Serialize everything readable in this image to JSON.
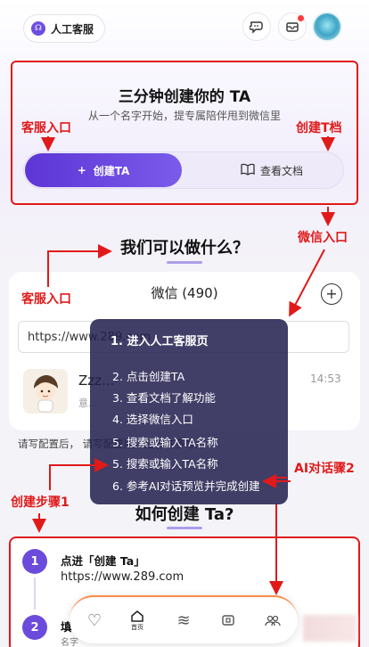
{
  "topbar": {
    "service_label": "人工客服",
    "service_icon": "headset-icon",
    "icons": [
      "chat-bubble-icon",
      "inbox-icon",
      "avatar"
    ]
  },
  "hero": {
    "title": "三分钟创建你的 TA",
    "subtitle": "从一个名字开始，提专属陪伴甩到微信里",
    "create_label": "创建TA",
    "docs_label": "查看文档"
  },
  "section1": {
    "title": "我们可以做什么？"
  },
  "wechat": {
    "title": "微信 (490)",
    "url_value": "https://www.289.com",
    "contact_name": "Zzz...",
    "contact_sub": "意...",
    "contact_time": "14:53"
  },
  "hint": "请写配置后，        请写配置后，还有许多导航",
  "section2": {
    "title": "如何创建 Ta?"
  },
  "steps": [
    {
      "num": "1",
      "title": "点进「创建 Ta」",
      "url": "https://www.289.com"
    },
    {
      "num": "2",
      "title": "填",
      "sub": "名字"
    }
  ],
  "nav": {
    "items": [
      "heart-icon",
      "home-icon",
      "waves-icon",
      "card-icon",
      "group-icon"
    ],
    "home_label": "首页"
  },
  "overlay": {
    "heading": "1. 进入人工客服页",
    "items": [
      "2. 点击创建TA",
      "3. 查看文档了解功能",
      "4. 选择微信入口",
      "5. 搜索或输入TA名称",
      "5. 搜索或输入TA名称",
      "6. 参考AI对话预览并完成创建"
    ]
  },
  "annotations": {
    "service_entry_1": "客服入口",
    "create_doc": "创建T档",
    "wechat_entry": "微信入口",
    "service_entry_2": "客服入口",
    "ai_dialog": "AI对话骤2",
    "create_step": "创建步骤1"
  },
  "colors": {
    "accent": "#5d35d6",
    "annotation": "#e01a1a",
    "overlay": "#221e4e"
  }
}
